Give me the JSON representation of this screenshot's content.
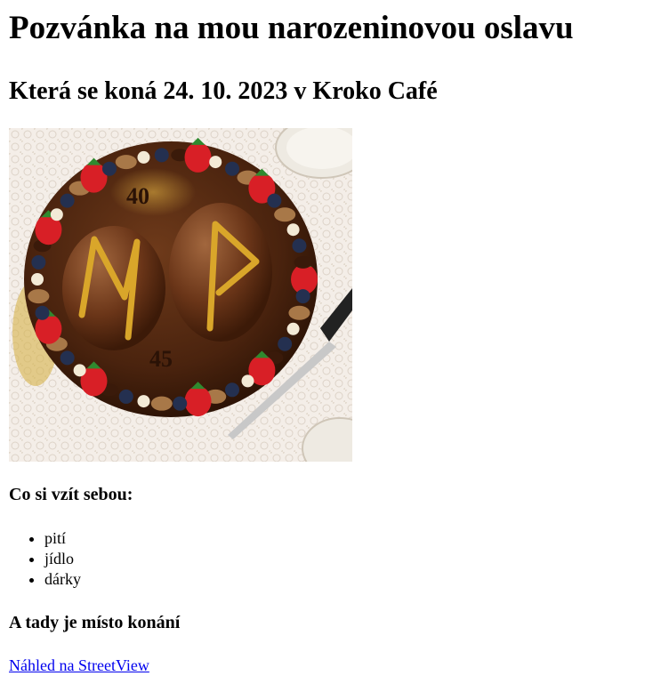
{
  "page": {
    "title": "Pozvánka na mou narozeninovou oslavu",
    "subtitle": "Která se koná 24. 10. 2023 v Kroko Café",
    "photo": {
      "numbers": [
        "40",
        "45"
      ]
    },
    "bring": {
      "heading": "Co si vzít sebou:",
      "items": [
        "pití",
        "jídlo",
        "dárky"
      ]
    },
    "venue": {
      "heading": "A tady je místo konání",
      "link_text": "Náhled na StreetView"
    }
  },
  "colors": {
    "link": "#0000ee",
    "text": "#000000",
    "background": "#ffffff"
  }
}
